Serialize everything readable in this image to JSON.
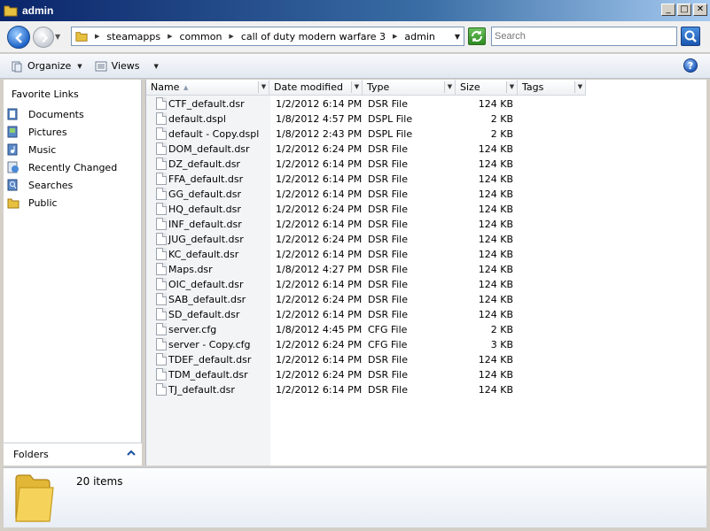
{
  "window": {
    "title": "admin",
    "minimize_glyph": "_",
    "maximize_glyph": "□",
    "close_glyph": "✕"
  },
  "address": {
    "crumbs": [
      "steamapps",
      "common",
      "call of duty modern warfare 3",
      "admin"
    ],
    "search_placeholder": "Search"
  },
  "toolbar": {
    "organize_label": "Organize",
    "views_label": "Views",
    "help_glyph": "?"
  },
  "navpane": {
    "favorites_title": "Favorite Links",
    "items": [
      {
        "label": "Documents",
        "icon": "documents-icon"
      },
      {
        "label": "Pictures",
        "icon": "pictures-icon"
      },
      {
        "label": "Music",
        "icon": "music-icon"
      },
      {
        "label": "Recently Changed",
        "icon": "recently-changed-icon"
      },
      {
        "label": "Searches",
        "icon": "searches-icon"
      },
      {
        "label": "Public",
        "icon": "public-folder-icon"
      }
    ],
    "folders_label": "Folders"
  },
  "columns": {
    "name": "Name",
    "date": "Date modified",
    "type": "Type",
    "size": "Size",
    "tags": "Tags"
  },
  "files": [
    {
      "name": "CTF_default.dsr",
      "date": "1/2/2012 6:14 PM",
      "type": "DSR File",
      "size": "124 KB"
    },
    {
      "name": "default.dspl",
      "date": "1/8/2012 4:57 PM",
      "type": "DSPL File",
      "size": "2 KB"
    },
    {
      "name": "default - Copy.dspl",
      "date": "1/8/2012 2:43 PM",
      "type": "DSPL File",
      "size": "2 KB"
    },
    {
      "name": "DOM_default.dsr",
      "date": "1/2/2012 6:24 PM",
      "type": "DSR File",
      "size": "124 KB"
    },
    {
      "name": "DZ_default.dsr",
      "date": "1/2/2012 6:14 PM",
      "type": "DSR File",
      "size": "124 KB"
    },
    {
      "name": "FFA_default.dsr",
      "date": "1/2/2012 6:14 PM",
      "type": "DSR File",
      "size": "124 KB"
    },
    {
      "name": "GG_default.dsr",
      "date": "1/2/2012 6:14 PM",
      "type": "DSR File",
      "size": "124 KB"
    },
    {
      "name": "HQ_default.dsr",
      "date": "1/2/2012 6:24 PM",
      "type": "DSR File",
      "size": "124 KB"
    },
    {
      "name": "INF_default.dsr",
      "date": "1/2/2012 6:14 PM",
      "type": "DSR File",
      "size": "124 KB"
    },
    {
      "name": "JUG_default.dsr",
      "date": "1/2/2012 6:24 PM",
      "type": "DSR File",
      "size": "124 KB"
    },
    {
      "name": "KC_default.dsr",
      "date": "1/2/2012 6:14 PM",
      "type": "DSR File",
      "size": "124 KB"
    },
    {
      "name": "Maps.dsr",
      "date": "1/8/2012 4:27 PM",
      "type": "DSR File",
      "size": "124 KB"
    },
    {
      "name": "OIC_default.dsr",
      "date": "1/2/2012 6:14 PM",
      "type": "DSR File",
      "size": "124 KB"
    },
    {
      "name": "SAB_default.dsr",
      "date": "1/2/2012 6:24 PM",
      "type": "DSR File",
      "size": "124 KB"
    },
    {
      "name": "SD_default.dsr",
      "date": "1/2/2012 6:14 PM",
      "type": "DSR File",
      "size": "124 KB"
    },
    {
      "name": "server.cfg",
      "date": "1/8/2012 4:45 PM",
      "type": "CFG File",
      "size": "2 KB"
    },
    {
      "name": "server - Copy.cfg",
      "date": "1/2/2012 6:24 PM",
      "type": "CFG File",
      "size": "3 KB"
    },
    {
      "name": "TDEF_default.dsr",
      "date": "1/2/2012 6:14 PM",
      "type": "DSR File",
      "size": "124 KB"
    },
    {
      "name": "TDM_default.dsr",
      "date": "1/2/2012 6:24 PM",
      "type": "DSR File",
      "size": "124 KB"
    },
    {
      "name": "TJ_default.dsr",
      "date": "1/2/2012 6:14 PM",
      "type": "DSR File",
      "size": "124 KB"
    }
  ],
  "details": {
    "item_count": "20 items"
  },
  "colors": {
    "titlebar": "#0a246a",
    "folder": "#e8c040",
    "window_frame": "#d4d0c8"
  }
}
